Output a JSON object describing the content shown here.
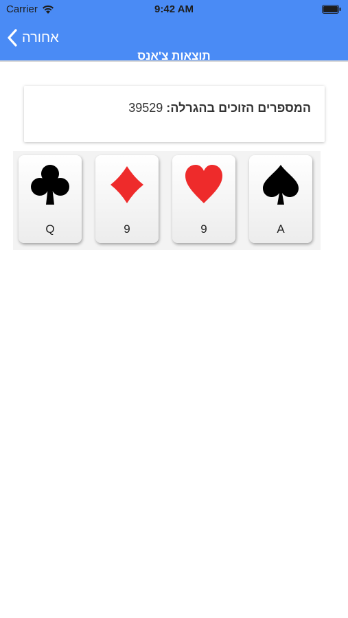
{
  "status_bar": {
    "carrier": "Carrier",
    "time": "9:42 AM",
    "wifi_icon": "wifi-icon",
    "battery_icon": "battery-icon"
  },
  "nav": {
    "back_label": "אחורה",
    "title": "תוצאות צ'אנס",
    "background_color": "#4a8bf5"
  },
  "result": {
    "label": "המספרים הזוכים בהגרלה:",
    "value": "39529"
  },
  "cards": [
    {
      "rank": "Q",
      "suit": "clubs",
      "suit_icon": "club-icon",
      "color": "#000000"
    },
    {
      "rank": "9",
      "suit": "diamonds",
      "suit_icon": "diamond-icon",
      "color": "#ee2b2b"
    },
    {
      "rank": "9",
      "suit": "hearts",
      "suit_icon": "heart-icon",
      "color": "#ee2b2b"
    },
    {
      "rank": "A",
      "suit": "spades",
      "suit_icon": "spade-icon",
      "color": "#000000"
    }
  ]
}
